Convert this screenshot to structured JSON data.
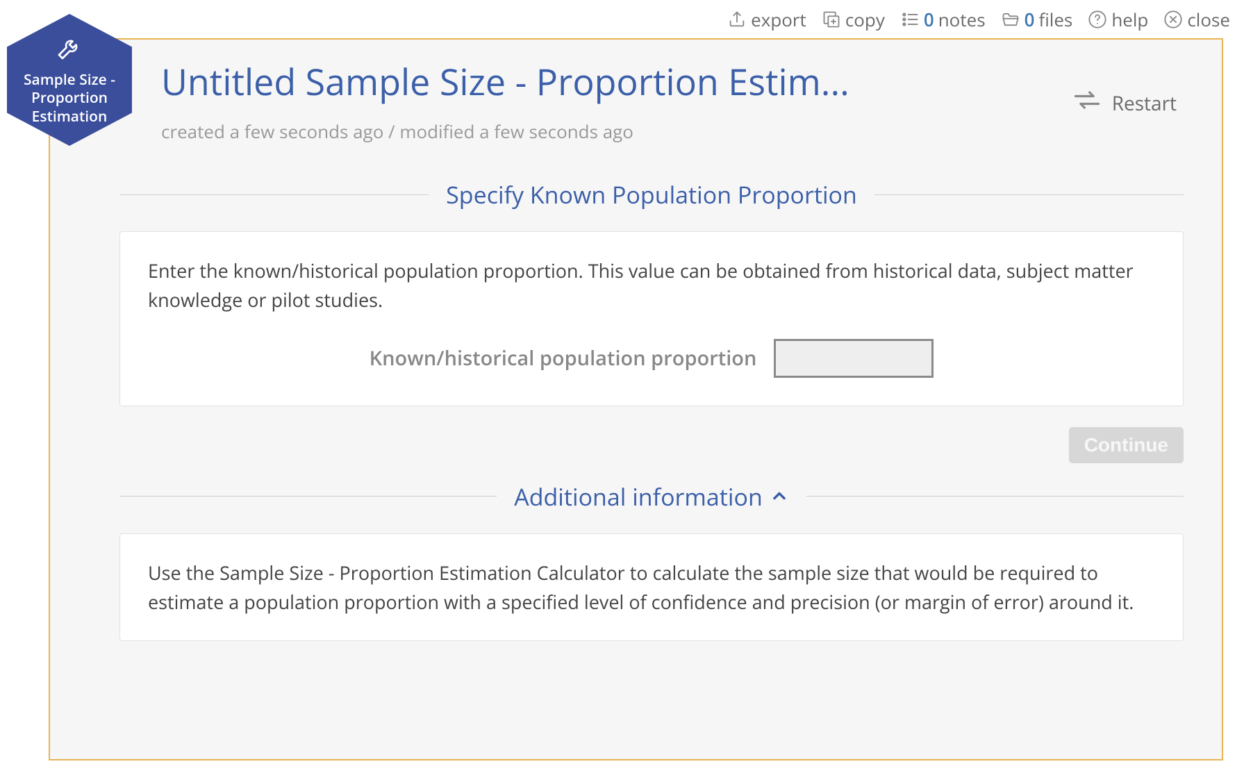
{
  "toolbar": {
    "export_label": "export",
    "copy_label": "copy",
    "notes_count": "0",
    "notes_label": "notes",
    "files_count": "0",
    "files_label": "files",
    "help_label": "help",
    "close_label": "close"
  },
  "badge": {
    "text": "Sample Size - Proportion Estimation"
  },
  "header": {
    "title": "Untitled Sample Size - Proportion Estim...",
    "timestamps": "created a few seconds ago / modified a few seconds ago",
    "restart_label": "Restart"
  },
  "section1": {
    "title": "Specify Known Population Proportion",
    "description": "Enter the known/historical population proportion. This value can be obtained from historical data, subject matter knowledge or pilot studies.",
    "input_label": "Known/historical population proportion",
    "input_value": ""
  },
  "continue_label": "Continue",
  "section2": {
    "title": "Additional information",
    "description": "Use the Sample Size - Proportion Estimation Calculator to calculate the sample size that would be required to estimate a population proportion with a specified level of confidence and precision (or margin of error) around it."
  }
}
